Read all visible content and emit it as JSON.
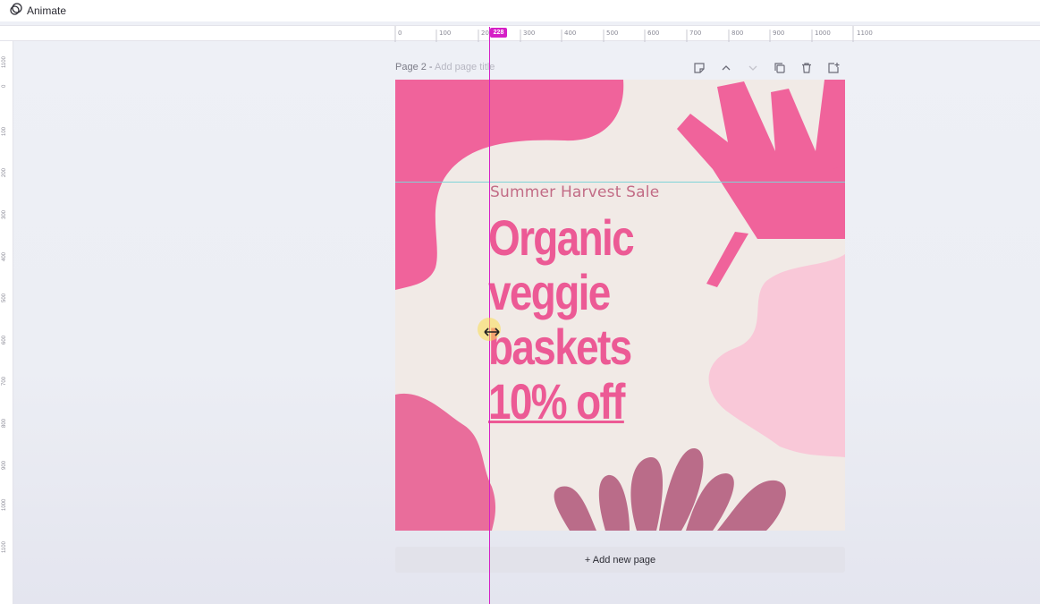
{
  "toolbar": {
    "animate_label": "Animate",
    "animate_icon": "animate-icon"
  },
  "ruler": {
    "h_ticks": [
      "0",
      "100",
      "20",
      "300",
      "400",
      "500",
      "600",
      "700",
      "800",
      "900",
      "1000",
      "1100"
    ],
    "v_ticks": [
      "1100",
      "0",
      "100",
      "200",
      "300",
      "400",
      "500",
      "600",
      "700",
      "800",
      "900",
      "1000",
      "1100"
    ],
    "position_badge": "228"
  },
  "page": {
    "label": "Page 2 - ",
    "title_placeholder": "Add page title",
    "tools": [
      "note-icon",
      "chevron-up-icon",
      "chevron-down-icon",
      "duplicate-icon",
      "trash-icon",
      "add-page-icon"
    ]
  },
  "design": {
    "subtitle": "Summer Harvest Sale",
    "headline": [
      "Organic",
      "veggie",
      "baskets",
      "10% off"
    ],
    "colors": {
      "pink": "#f0639b",
      "light_pink": "#f9c8d8",
      "mauve": "#ba6c89",
      "background": "#f1eae6",
      "text_pink": "#ec5a95"
    }
  },
  "add_page_label": "+ Add new page",
  "guide_color": "#d51fc6"
}
